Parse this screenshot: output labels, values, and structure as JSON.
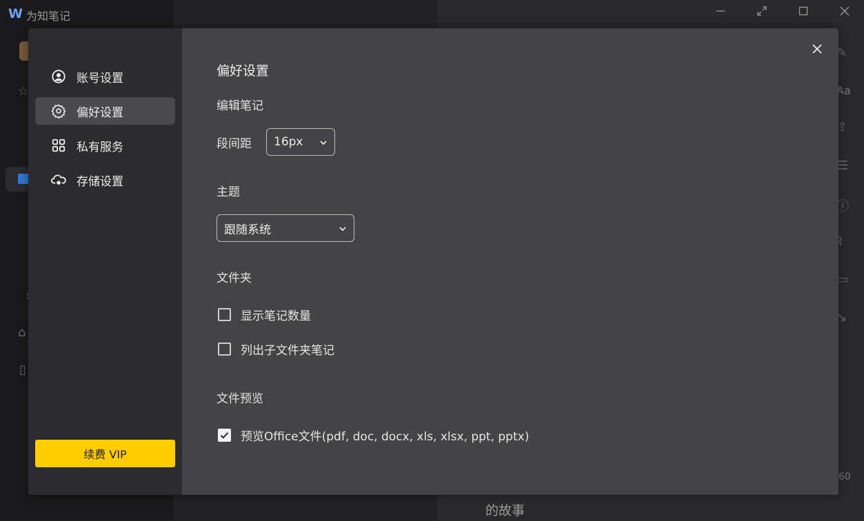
{
  "app": {
    "title": "为知笔记",
    "logo": "W",
    "bg_story_text": "的故事",
    "bg_count_text": "60",
    "bg_font_icon_text": "Aa"
  },
  "sidebar": {
    "items": [
      {
        "label": "账号设置",
        "icon": "user-circle-icon",
        "active": false
      },
      {
        "label": "偏好设置",
        "icon": "gear-icon",
        "active": true
      },
      {
        "label": "私有服务",
        "icon": "grid-apps-icon",
        "active": false
      },
      {
        "label": "存储设置",
        "icon": "cloud-storage-icon",
        "active": false
      }
    ],
    "vip_button": "续费 VIP"
  },
  "content": {
    "title": "偏好设置",
    "edit_section": "编辑笔记",
    "paragraph_spacing_label": "段间距",
    "paragraph_spacing_value": "16px",
    "theme_section": "主题",
    "theme_value": "跟随系统",
    "folder_section": "文件夹",
    "show_note_count": {
      "label": "显示笔记数量",
      "checked": false
    },
    "list_subfolder_notes": {
      "label": "列出子文件夹笔记",
      "checked": false
    },
    "preview_section": "文件预览",
    "preview_office": {
      "label": "预览Office文件(pdf, doc, docx, xls, xlsx, ppt, pptx)",
      "checked": true
    }
  },
  "colors": {
    "accent_vip": "#ffcc00",
    "dialog_bg": "#444447",
    "sidebar_bg": "#2c2c2f",
    "active_item_bg": "#4a4a4e"
  }
}
